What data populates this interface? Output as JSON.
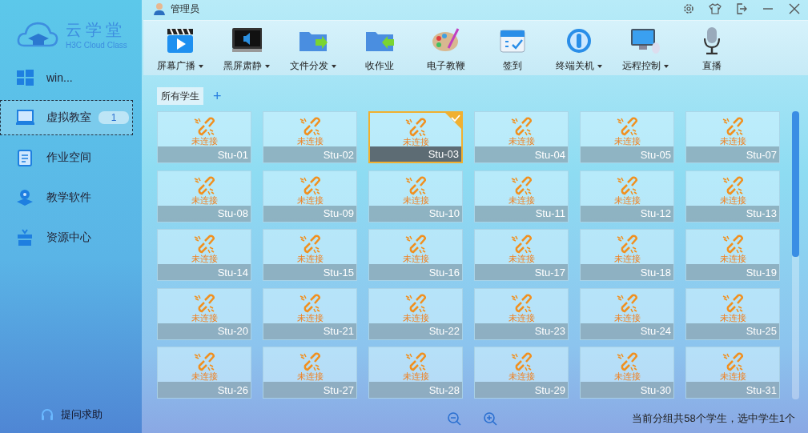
{
  "brand": {
    "name": "云学堂",
    "subtitle": "H3C Cloud Class"
  },
  "user": {
    "name": "管理员"
  },
  "sidebar": {
    "items": [
      {
        "label": "win...",
        "selected": false
      },
      {
        "label": "虚拟教室",
        "badge": "1",
        "selected": true
      },
      {
        "label": "作业空间",
        "selected": false
      },
      {
        "label": "教学软件",
        "selected": false
      },
      {
        "label": "资源中心",
        "selected": false
      }
    ],
    "help": "提问求助"
  },
  "toolbar": [
    {
      "label": "屏幕广播",
      "dropdown": true
    },
    {
      "label": "黑屏肃静",
      "dropdown": true
    },
    {
      "label": "文件分发",
      "dropdown": true
    },
    {
      "label": "收作业",
      "dropdown": false
    },
    {
      "label": "电子教鞭",
      "dropdown": false
    },
    {
      "label": "签到",
      "dropdown": false
    },
    {
      "label": "终端关机",
      "dropdown": true
    },
    {
      "label": "远程控制",
      "dropdown": true
    },
    {
      "label": "直播",
      "dropdown": false
    }
  ],
  "groups": [
    {
      "label": "所有学生",
      "selected": true
    }
  ],
  "add_group": "+",
  "students": [
    {
      "name": "Stu-01",
      "status": "未连接",
      "selected": false
    },
    {
      "name": "Stu-02",
      "status": "未连接",
      "selected": false
    },
    {
      "name": "Stu-03",
      "status": "未连接",
      "selected": true
    },
    {
      "name": "Stu-04",
      "status": "未连接",
      "selected": false
    },
    {
      "name": "Stu-05",
      "status": "未连接",
      "selected": false
    },
    {
      "name": "Stu-07",
      "status": "未连接",
      "selected": false
    },
    {
      "name": "Stu-08",
      "status": "未连接",
      "selected": false
    },
    {
      "name": "Stu-09",
      "status": "未连接",
      "selected": false
    },
    {
      "name": "Stu-10",
      "status": "未连接",
      "selected": false
    },
    {
      "name": "Stu-11",
      "status": "未连接",
      "selected": false
    },
    {
      "name": "Stu-12",
      "status": "未连接",
      "selected": false
    },
    {
      "name": "Stu-13",
      "status": "未连接",
      "selected": false
    },
    {
      "name": "Stu-14",
      "status": "未连接",
      "selected": false
    },
    {
      "name": "Stu-15",
      "status": "未连接",
      "selected": false
    },
    {
      "name": "Stu-16",
      "status": "未连接",
      "selected": false
    },
    {
      "name": "Stu-17",
      "status": "未连接",
      "selected": false
    },
    {
      "name": "Stu-18",
      "status": "未连接",
      "selected": false
    },
    {
      "name": "Stu-19",
      "status": "未连接",
      "selected": false
    },
    {
      "name": "Stu-20",
      "status": "未连接",
      "selected": false
    },
    {
      "name": "Stu-21",
      "status": "未连接",
      "selected": false
    },
    {
      "name": "Stu-22",
      "status": "未连接",
      "selected": false
    },
    {
      "name": "Stu-23",
      "status": "未连接",
      "selected": false
    },
    {
      "name": "Stu-24",
      "status": "未连接",
      "selected": false
    },
    {
      "name": "Stu-25",
      "status": "未连接",
      "selected": false
    },
    {
      "name": "Stu-26",
      "status": "未连接",
      "selected": false
    },
    {
      "name": "Stu-27",
      "status": "未连接",
      "selected": false
    },
    {
      "name": "Stu-28",
      "status": "未连接",
      "selected": false
    },
    {
      "name": "Stu-29",
      "status": "未连接",
      "selected": false
    },
    {
      "name": "Stu-30",
      "status": "未连接",
      "selected": false
    },
    {
      "name": "Stu-31",
      "status": "未连接",
      "selected": false
    }
  ],
  "status_bar": "当前分组共58个学生，选中学生1个"
}
